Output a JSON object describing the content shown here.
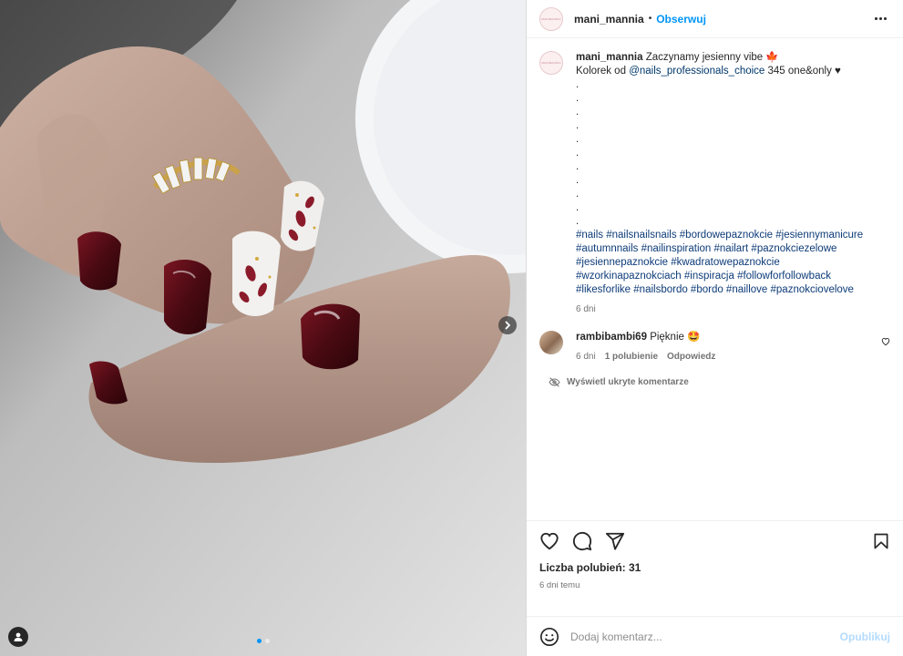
{
  "post": {
    "header": {
      "username": "mani_mannia",
      "separator": "•",
      "follow_label": "Obserwuj",
      "avatar_logo_text": "MANIMANNIA"
    },
    "caption": {
      "username": "mani_mannia",
      "line1": "Zaczynamy jesienny vibe",
      "line1_emoji": "🍁",
      "line2_prefix": "Kolorek od",
      "mention": "@nails_professionals_choice",
      "line2_suffix": "345 one&only ♥",
      "dots": [
        ".",
        ".",
        ".",
        ".",
        ".",
        ".",
        ".",
        ".",
        ".",
        ".",
        "."
      ],
      "hashtags_lines": [
        "#nails #nailsnailsnails #bordowepaznokcie #jesiennymanicure",
        "#autumnnails #nailinspiration #nailart #paznokciezelowe",
        "#jesiennepaznokcie #kwadratowepaznokcie",
        "#wzorkinapaznokciach #inspiracja #followforfollowback",
        "#likesforlike #nailsbordo #bordo #naillove #paznokciovelove"
      ],
      "age": "6 dni"
    },
    "comments": [
      {
        "username": "rambibambi69",
        "text": "Pięknie 🤩",
        "age": "6 dni",
        "likes": "1 polubienie",
        "reply": "Odpowiedz"
      }
    ],
    "hidden_comments_label": "Wyświetl ukryte komentarze",
    "likes_label": "Liczba polubień: 31",
    "time_label": "6 dni temu",
    "add_comment": {
      "placeholder": "Dodaj komentarz...",
      "publish_label": "Opublikuj"
    },
    "carousel": {
      "current": 1,
      "total": 2
    }
  },
  "icons": {
    "more": "more-horizontal-icon",
    "like": "heart-icon",
    "comment": "comment-bubble-icon",
    "share": "paper-plane-icon",
    "save": "bookmark-icon",
    "emoji": "smiley-icon",
    "hidden": "eye-off-icon",
    "next": "chevron-right-icon",
    "tag": "user-tag-icon"
  },
  "colors": {
    "link": "#0095f6",
    "hashtag": "#00376b",
    "muted": "#737373",
    "publish_disabled": "#b3dbff",
    "nail_burgundy": "#4a0a12"
  }
}
